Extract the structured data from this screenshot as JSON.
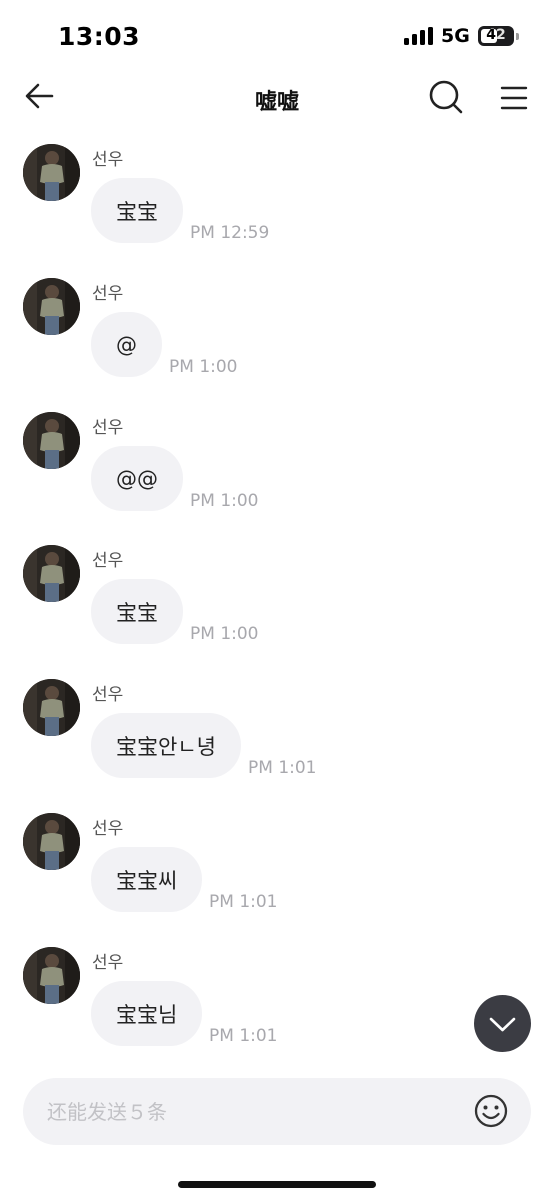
{
  "status_bar": {
    "time": "13:03",
    "network": "5G",
    "battery": "42"
  },
  "nav": {
    "title": "嘘嘘",
    "back_icon": "arrow-left-icon",
    "search_icon": "search-icon",
    "menu_icon": "hamburger-menu-icon"
  },
  "messages": [
    {
      "sender": "선우",
      "text": "宝宝",
      "time": "PM 12:59"
    },
    {
      "sender": "선우",
      "text": "@",
      "time": "PM 1:00"
    },
    {
      "sender": "선우",
      "text": "@@",
      "time": "PM 1:00"
    },
    {
      "sender": "선우",
      "text": "宝宝",
      "time": "PM 1:00"
    },
    {
      "sender": "선우",
      "text": "宝宝안ㄴ녕",
      "time": "PM 1:01"
    },
    {
      "sender": "선우",
      "text": "宝宝씨",
      "time": "PM 1:01"
    },
    {
      "sender": "선우",
      "text": "宝宝님",
      "time": "PM 1:01"
    }
  ],
  "input": {
    "placeholder": "还能发送５条",
    "emoji_icon": "smiley-icon"
  },
  "scroll_down_icon": "chevron-down-icon"
}
